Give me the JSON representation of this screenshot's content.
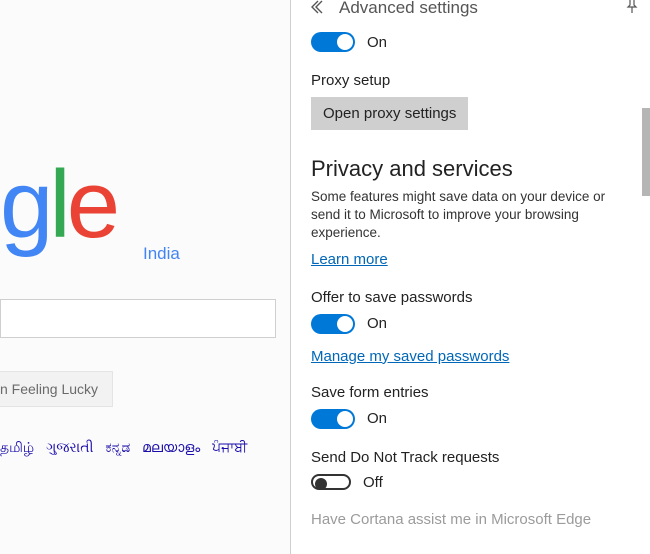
{
  "google": {
    "logo_g2": "g",
    "logo_l": "l",
    "logo_e": "e",
    "region": "India",
    "lucky": "n Feeling Lucky",
    "langs": [
      "தமிழ்",
      "ગુજરાતી",
      "ಕನ್ನಡ",
      "മലയാളം",
      "ਪੰਜਾਬੀ"
    ]
  },
  "panel": {
    "title": "Advanced settings",
    "top_toggle": {
      "state": "On"
    },
    "proxy": {
      "label": "Proxy setup",
      "button": "Open proxy settings"
    },
    "privacy": {
      "heading": "Privacy and services",
      "desc": "Some features might save data on your device or send it to Microsoft to improve your browsing experience.",
      "learn_more": "Learn more"
    },
    "save_passwords": {
      "label": "Offer to save passwords",
      "state": "On",
      "manage_link": "Manage my saved passwords"
    },
    "form_entries": {
      "label": "Save form entries",
      "state": "On"
    },
    "dnt": {
      "label": "Send Do Not Track requests",
      "state": "Off"
    },
    "cortana": {
      "label": "Have Cortana assist me in Microsoft Edge"
    }
  }
}
